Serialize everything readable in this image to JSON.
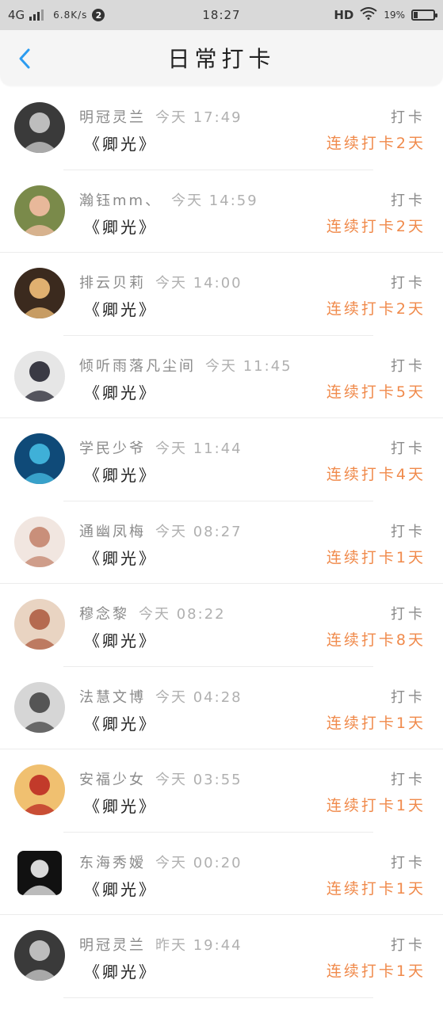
{
  "status_bar": {
    "network": "4G",
    "speed": "6.8K/s",
    "notification_badge": "2",
    "time": "18:27",
    "hd": "HD",
    "battery": "19%",
    "battery_level": 0.19
  },
  "header": {
    "title": "日常打卡",
    "back_icon": "chevron-left-icon",
    "accent_color": "#2c9cf0"
  },
  "list": {
    "items": [
      {
        "name": "明冠灵兰",
        "time": "今天 17:49",
        "subject": "《卿光》",
        "action": "打卡",
        "streak": "连续打卡2天",
        "avatar": {
          "bg": "#3a3a3a",
          "fg": "#bdbdbd",
          "shape": "circle"
        }
      },
      {
        "name": "瀚钰mm、",
        "time": "今天 14:59",
        "subject": "《卿光》",
        "action": "打卡",
        "streak": "连续打卡2天",
        "avatar": {
          "bg": "#7a8a4a",
          "fg": "#e8b89a",
          "shape": "circle"
        }
      },
      {
        "name": "排云贝莉",
        "time": "今天 14:00",
        "subject": "《卿光》",
        "action": "打卡",
        "streak": "连续打卡2天",
        "avatar": {
          "bg": "#3b2a1e",
          "fg": "#e0b070",
          "shape": "circle"
        }
      },
      {
        "name": "倾听雨落凡尘间",
        "time": "今天 11:45",
        "subject": "《卿光》",
        "action": "打卡",
        "streak": "连续打卡5天",
        "avatar": {
          "bg": "#e6e6e6",
          "fg": "#3a3a44",
          "shape": "circle"
        }
      },
      {
        "name": "学民少爷",
        "time": "今天 11:44",
        "subject": "《卿光》",
        "action": "打卡",
        "streak": "连续打卡4天",
        "avatar": {
          "bg": "#0f4a78",
          "fg": "#3fb0d8",
          "shape": "circle"
        }
      },
      {
        "name": "通幽凤梅",
        "time": "今天 08:27",
        "subject": "《卿光》",
        "action": "打卡",
        "streak": "连续打卡1天",
        "avatar": {
          "bg": "#f1e6e0",
          "fg": "#c98f7a",
          "shape": "circle"
        }
      },
      {
        "name": "穆念黎",
        "time": "今天 08:22",
        "subject": "《卿光》",
        "action": "打卡",
        "streak": "连续打卡8天",
        "avatar": {
          "bg": "#e9d4c2",
          "fg": "#b56a50",
          "shape": "circle"
        }
      },
      {
        "name": "法慧文博",
        "time": "今天 04:28",
        "subject": "《卿光》",
        "action": "打卡",
        "streak": "连续打卡1天",
        "avatar": {
          "bg": "#d6d6d6",
          "fg": "#555555",
          "shape": "circle"
        }
      },
      {
        "name": "安福少女",
        "time": "今天 03:55",
        "subject": "《卿光》",
        "action": "打卡",
        "streak": "连续打卡1天",
        "avatar": {
          "bg": "#f0c070",
          "fg": "#c23a2a",
          "shape": "circle"
        }
      },
      {
        "name": "东海秀嫒",
        "time": "今天 00:20",
        "subject": "《卿光》",
        "action": "打卡",
        "streak": "连续打卡1天",
        "avatar": {
          "bg": "#111111",
          "fg": "#d9d9d9",
          "shape": "square"
        }
      },
      {
        "name": "明冠灵兰",
        "time": "昨天 19:44",
        "subject": "《卿光》",
        "action": "打卡",
        "streak": "连续打卡1天",
        "avatar": {
          "bg": "#3a3a3a",
          "fg": "#bdbdbd",
          "shape": "circle"
        }
      }
    ]
  },
  "colors": {
    "streak": "#f08a4b",
    "name": "#8a8a8a",
    "subject": "#222222"
  }
}
